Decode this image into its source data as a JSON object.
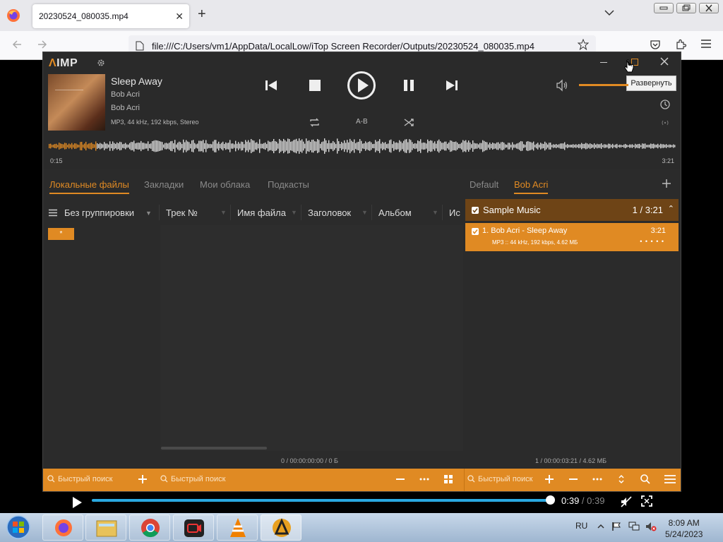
{
  "browser": {
    "tab_title": "20230524_080035.mp4",
    "url": "file:///C:/Users/vm1/AppData/LocalLow/iTop Screen Recorder/Outputs/20230524_080035.mp4"
  },
  "player": {
    "logo_prefix": "Λ",
    "logo_text": "IMP",
    "track": {
      "title": "Sleep Away",
      "artist": "Bob Acri",
      "album": "Bob Acri",
      "info": "MP3, 44 kHz, 192 kbps, Stereo",
      "position": "0:15",
      "duration": "3:21",
      "progress": 0.075
    },
    "ab_label": "A-B",
    "tooltip": "Развернуть",
    "accent": "#e08a23",
    "library_tabs": [
      "Локальные файлы",
      "Закладки",
      "Мои облака",
      "Подкасты"
    ],
    "grouping": "Без группировки",
    "columns": [
      "Трек №",
      "Имя файла",
      "Заголовок",
      "Альбом",
      "Ис"
    ],
    "star_item": "*",
    "playlist_tabs": [
      "Default",
      "Bob Acri"
    ],
    "playlist_group": {
      "name": "Sample Music",
      "count": "1 / 3:21"
    },
    "playlist_item": {
      "title": "1. Bob Acri - Sleep Away",
      "time": "3:21",
      "info": "MP3 :: 44 kHz, 192 kbps, 4.62 МБ",
      "dots": "• • • • •"
    },
    "library_status": "0 / 00:00:00:00 / 0 Б",
    "playlist_status": "1 / 00:00:03:21 / 4.62 МБ",
    "quick_search": "Быстрый поиск"
  },
  "video": {
    "current": "0:39",
    "sep": " / ",
    "duration": "0:39",
    "progress": 1.0
  },
  "taskbar": {
    "lang": "RU",
    "time": "8:09 AM",
    "date": "5/24/2023"
  }
}
